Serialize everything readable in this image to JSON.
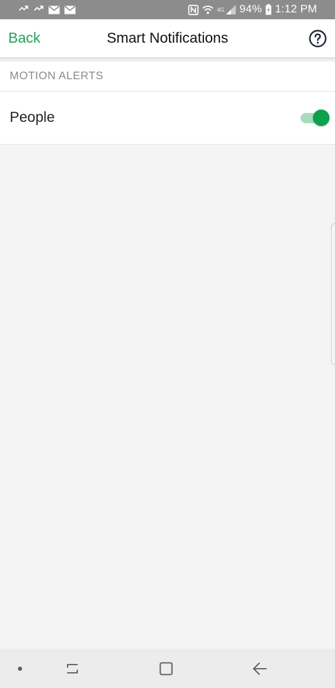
{
  "status_bar": {
    "battery_percent": "94%",
    "time": "1:12 PM",
    "network_label": "4G",
    "left_icons": [
      "sync-icon",
      "sync-icon",
      "mail-icon",
      "mail-icon"
    ],
    "right_icons": [
      "nfc-icon",
      "wifi-icon",
      "signal-icon",
      "battery-charging-icon"
    ]
  },
  "app_bar": {
    "back_label": "Back",
    "title": "Smart Notifications",
    "help_icon": "question-circle-icon"
  },
  "section": {
    "header": "MOTION ALERTS",
    "items": [
      {
        "label": "People",
        "enabled": true
      }
    ]
  },
  "navigation_bar": {
    "buttons": [
      "dot-icon",
      "recents-icon",
      "home-icon",
      "back-arrow-icon"
    ]
  },
  "colors": {
    "accent": "#1fa254",
    "toggle_on": "#0da14b",
    "toggle_track": "#a9dcbd",
    "background": "#f4f4f4",
    "status_bar": "#8c8c8c"
  }
}
